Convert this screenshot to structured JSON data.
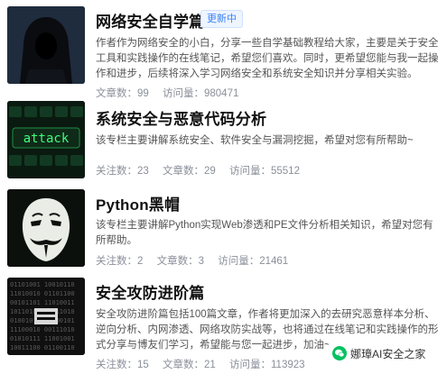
{
  "columns": [
    {
      "title": "网络安全自学篇",
      "badge": "更新中",
      "description": "作者作为网络安全的小白，分享一些自学基础教程给大家，主要是关于安全工具和实践操作的在线笔记，希望您们喜欢。同时，更希望您能与我一起操作和进步，后续将深入学习网络安全和系统安全知识并分享相关实验。",
      "stats": [
        {
          "label": "文章数：",
          "value": "99"
        },
        {
          "label": "访问量：",
          "value": "980471"
        }
      ],
      "thumb_icon": "hooded-hacker-icon"
    },
    {
      "title": "系统安全与恶意代码分析",
      "description": "该专栏主要讲解系统安全、软件安全与漏洞挖掘，希望对您有所帮助~",
      "stats": [
        {
          "label": "关注数：",
          "value": "23"
        },
        {
          "label": "文章数：",
          "value": "29"
        },
        {
          "label": "访问量：",
          "value": "55512"
        }
      ],
      "thumb_text": "attack",
      "thumb_icon": "attack-keyboard-icon"
    },
    {
      "title": "Python黑帽",
      "description": "该专栏主要讲解Python实现Web渗透和PE文件分析相关知识，希望对您有所帮助。",
      "stats": [
        {
          "label": "关注数：",
          "value": "2"
        },
        {
          "label": "文章数：",
          "value": "3"
        },
        {
          "label": "访问量：",
          "value": "21461"
        }
      ],
      "thumb_icon": "guy-fawkes-mask-icon"
    },
    {
      "title": "安全攻防进阶篇",
      "description": "安全攻防进阶篇包括100篇文章，作者将更加深入的去研究恶意样本分析、逆向分析、内网渗透、网络攻防实战等，也将通过在线笔记和实践操作的形式分享与博友们学习，希望能与您一起进步，加油~",
      "stats": [
        {
          "label": "关注数：",
          "value": "15"
        },
        {
          "label": "文章数：",
          "value": "21"
        },
        {
          "label": "访问量：",
          "value": "113923"
        }
      ],
      "thumb_icon": "binary-code-icon"
    }
  ],
  "watermark": "娜璋AI安全之家",
  "colors": {
    "badge_text": "#3b82f6",
    "meta_text": "#8a8f99",
    "wechat_green": "#07c160"
  }
}
